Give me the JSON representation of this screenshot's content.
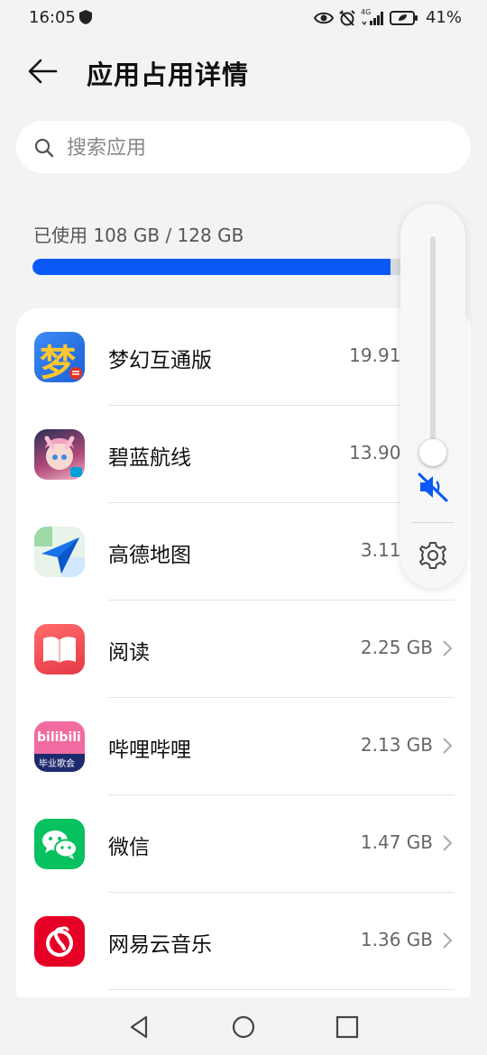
{
  "status_bar": {
    "time": "16:05",
    "network_label": "4G",
    "battery_text": "41%",
    "battery_level": 0.41
  },
  "header": {
    "title": "应用占用详情"
  },
  "search": {
    "placeholder": "搜索应用"
  },
  "storage": {
    "usage_text": "已使用 108 GB / 128 GB",
    "used_gb": 108,
    "total_gb": 128
  },
  "apps": [
    {
      "name": "梦幻互通版",
      "size": "19.91 GB",
      "icon": "menghuan-app-icon"
    },
    {
      "name": "碧蓝航线",
      "size": "13.90 GB",
      "icon": "azurlane-app-icon"
    },
    {
      "name": "高德地图",
      "size": "3.11 GB",
      "icon": "amap-app-icon"
    },
    {
      "name": "阅读",
      "size": "2.25 GB",
      "icon": "reader-app-icon"
    },
    {
      "name": "哔哩哔哩",
      "size": "2.13 GB",
      "icon": "bilibili-app-icon"
    },
    {
      "name": "微信",
      "size": "1.47 GB",
      "icon": "wechat-app-icon"
    },
    {
      "name": "网易云音乐",
      "size": "1.36 GB",
      "icon": "netease-music-app-icon"
    }
  ],
  "app_icon_labels": {
    "menghuan": "梦",
    "bilibili": "bilibili",
    "bilibili_sub": "毕业歌会"
  },
  "volume_panel": {
    "level": 0.0,
    "muted": true
  },
  "colors": {
    "accent": "#0a59f7",
    "background": "#f1f3f5"
  }
}
